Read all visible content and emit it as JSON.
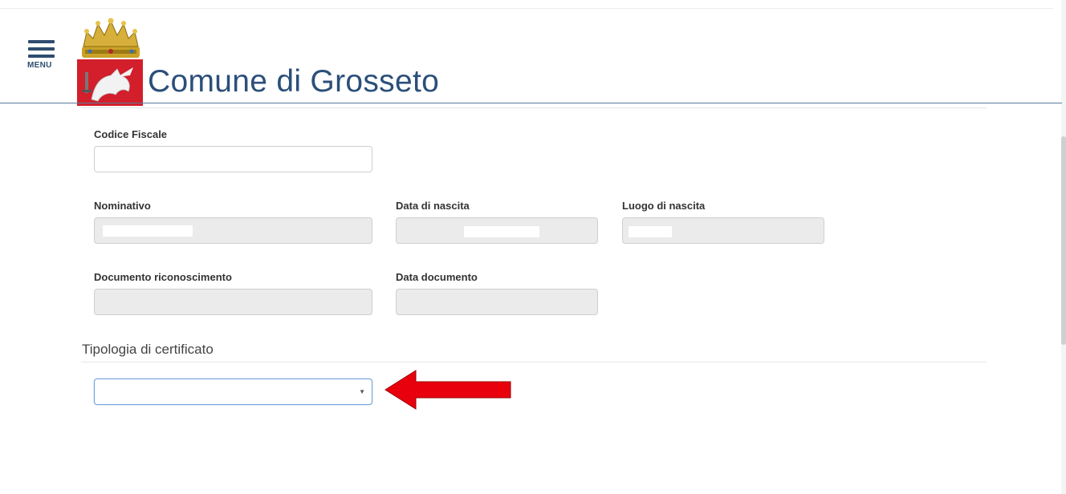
{
  "header": {
    "menu_label": "MENU",
    "site_title": "Comune di Grosseto"
  },
  "form": {
    "codice_fiscale": {
      "label": "Codice Fiscale",
      "value": ""
    },
    "nominativo": {
      "label": "Nominativo",
      "value": ""
    },
    "data_nascita": {
      "label": "Data di nascita",
      "value": ""
    },
    "luogo_nascita": {
      "label": "Luogo di nascita",
      "value": ""
    },
    "documento": {
      "label": "Documento riconoscimento",
      "value": ""
    },
    "data_documento": {
      "label": "Data documento",
      "value": ""
    }
  },
  "certificato": {
    "section_title": "Tipologia di certificato",
    "selected": ""
  },
  "colors": {
    "brand_blue": "#2b4f7a",
    "shield_red": "#d21f2b",
    "crown_gold": "#c9a227",
    "arrow_red": "#e8000d"
  }
}
